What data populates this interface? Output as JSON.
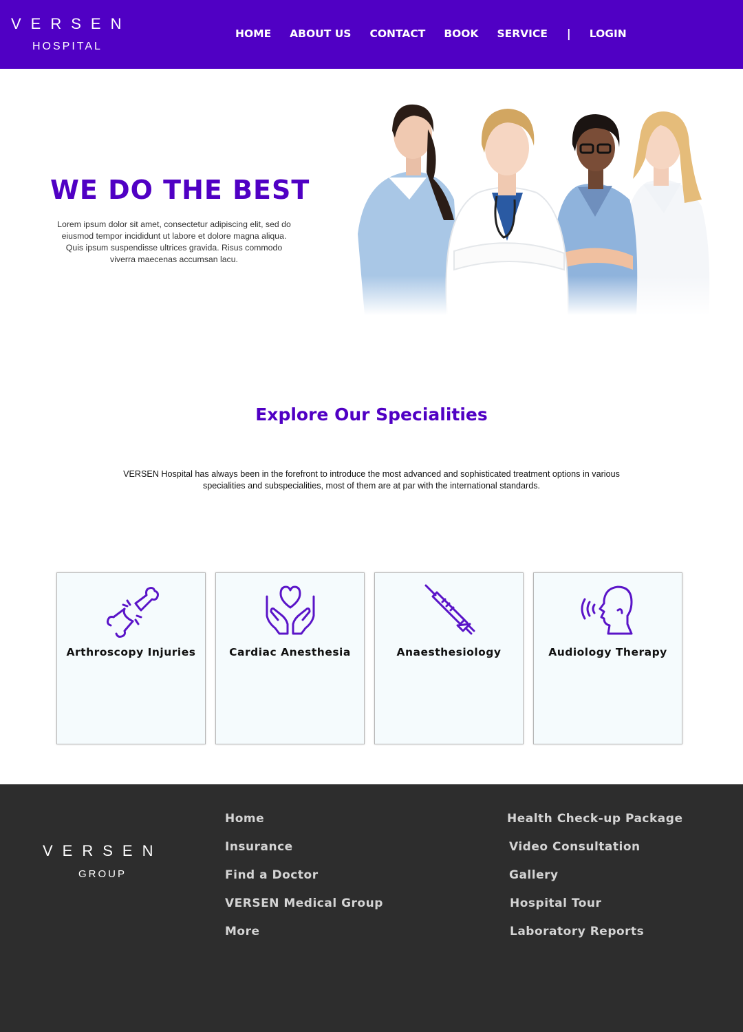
{
  "header": {
    "logo_word": "VERSEN",
    "logo_sub": "HOSPITAL",
    "nav": [
      "HOME",
      "ABOUT US",
      "CONTACT",
      "BOOK",
      "SERVICE"
    ],
    "separator": "|",
    "login": "LOGIN"
  },
  "hero": {
    "title": "WE DO THE BEST",
    "text": "Lorem ipsum dolor sit amet, consectetur adipiscing elit, sed do eiusmod tempor incididunt ut labore et dolore magna aliqua. Quis ipsum suspendisse ultrices gravida. Risus commodo viverra maecenas accumsan lacu."
  },
  "specialities": {
    "title": "Explore Our Specialities",
    "description": "VERSEN Hospital has always been in the forefront to introduce the most advanced and sophisticated treatment options in various specialities and subspecialities, most of them are at par with the international standards.",
    "cards": [
      {
        "label": "Arthroscopy Injuries",
        "icon": "broken-bone-icon"
      },
      {
        "label": "Cardiac Anesthesia",
        "icon": "heart-hands-icon"
      },
      {
        "label": "Anaesthesiology",
        "icon": "syringe-icon"
      },
      {
        "label": "Audiology Therapy",
        "icon": "head-sound-icon"
      }
    ]
  },
  "footer": {
    "logo_word": "VERSEN",
    "logo_sub": "GROUP",
    "links_col1": [
      "Home",
      "Insurance",
      "Find a Doctor",
      "VERSEN Medical Group",
      "More"
    ],
    "links_col2": [
      "Health Check-up Package",
      "Video Consultation",
      "Gallery",
      "Hospital Tour",
      "Laboratory Reports"
    ]
  },
  "colors": {
    "brand": "#5000c4",
    "footer_bg": "#2d2d2d",
    "card_bg": "#f5fbfd"
  }
}
